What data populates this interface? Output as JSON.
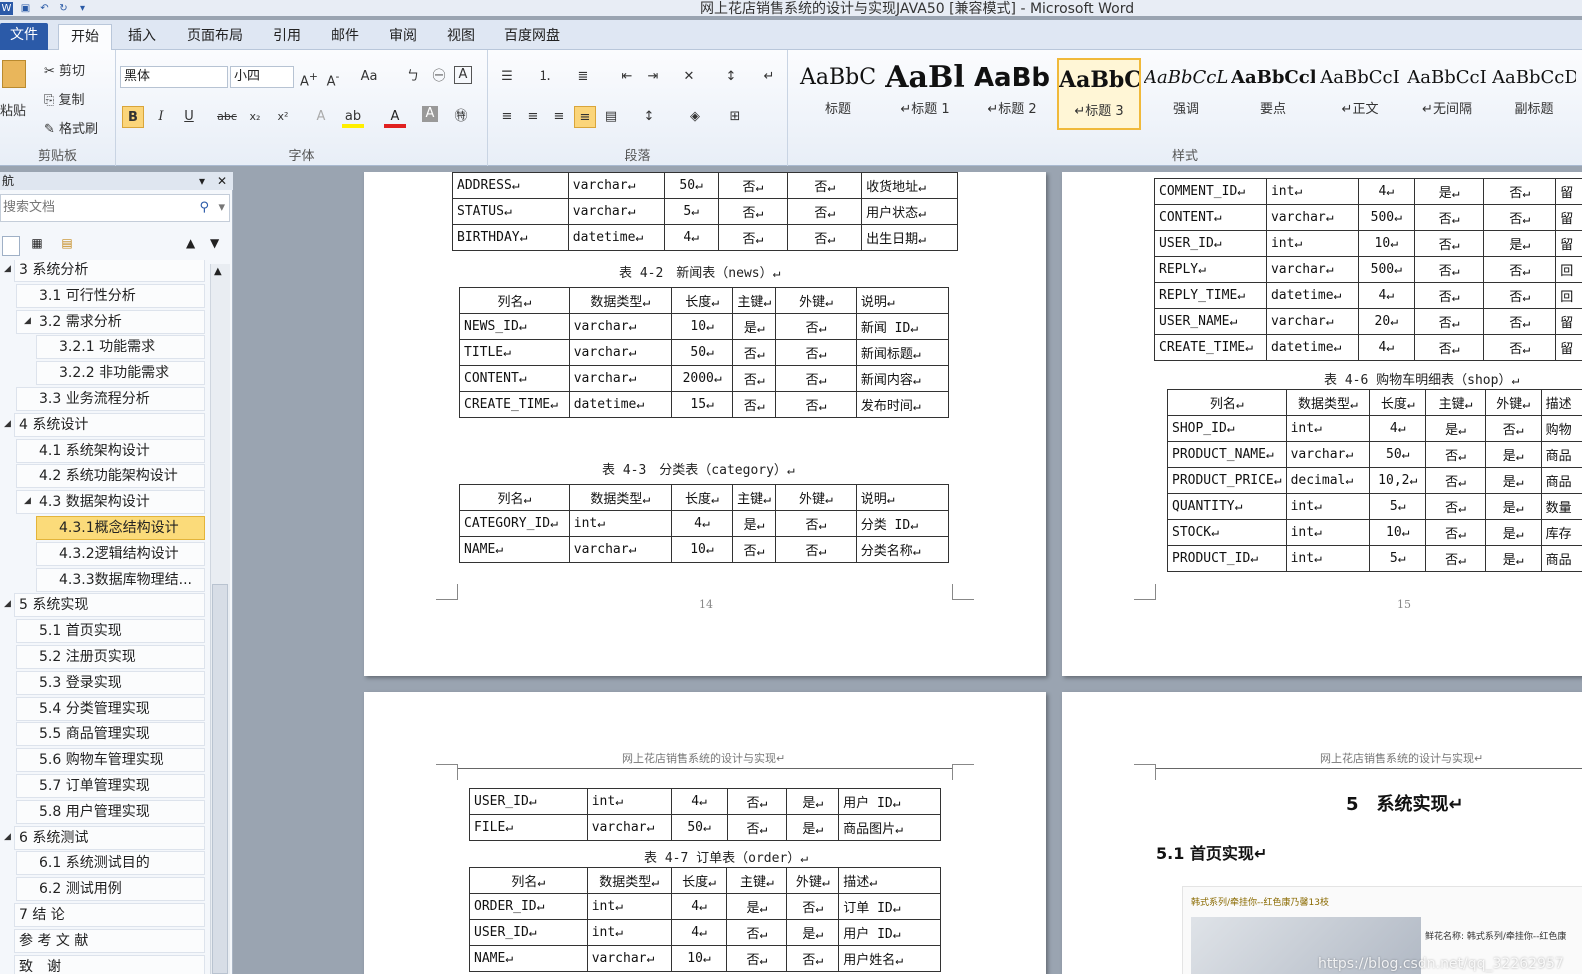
{
  "window": {
    "title": "网上花店销售系统的设计与实现JAVA50 [兼容模式] - Microsoft Word"
  },
  "tabs": [
    "文件",
    "开始",
    "插入",
    "页面布局",
    "引用",
    "邮件",
    "审阅",
    "视图",
    "百度网盘"
  ],
  "ribbon": {
    "clipboard": {
      "paste": "粘贴",
      "cut": "剪切",
      "copy": "复制",
      "format_painter": "格式刷",
      "label": "剪贴板"
    },
    "font": {
      "name": "黑体",
      "size": "小四",
      "label": "字体"
    },
    "paragraph": {
      "label": "段落"
    },
    "styles": {
      "label": "样式",
      "items": [
        {
          "sample": "AaBbC",
          "name": "标题"
        },
        {
          "sample": "AaBl",
          "name": "↵标题 1"
        },
        {
          "sample": "AaBb",
          "name": "↵标题 2"
        },
        {
          "sample": "AaBbC",
          "name": "↵标题 3"
        },
        {
          "sample": "AaBbCcL",
          "name": "强调"
        },
        {
          "sample": "AaBbCcl",
          "name": "要点"
        },
        {
          "sample": "AaBbCcI",
          "name": "↵正文"
        },
        {
          "sample": "AaBbCcI",
          "name": "↵无间隔"
        },
        {
          "sample": "AaBbCcD",
          "name": "副标题"
        }
      ]
    }
  },
  "nav": {
    "title": "航",
    "search_placeholder": "搜索文档",
    "items": [
      {
        "label": "3 系统分析",
        "level": 1
      },
      {
        "label": "3.1 可行性分析",
        "level": 2
      },
      {
        "label": "3.2 需求分析",
        "level": 2
      },
      {
        "label": "3.2.1 功能需求",
        "level": 3
      },
      {
        "label": "3.2.2 非功能需求",
        "level": 3
      },
      {
        "label": "3.3 业务流程分析",
        "level": 2
      },
      {
        "label": "4 系统设计",
        "level": 1
      },
      {
        "label": "4.1 系统架构设计",
        "level": 2
      },
      {
        "label": "4.2 系统功能架构设计",
        "level": 2
      },
      {
        "label": "4.3 数据架构设计",
        "level": 2
      },
      {
        "label": "4.3.1概念结构设计",
        "level": 3
      },
      {
        "label": "4.3.2逻辑结构设计",
        "level": 3
      },
      {
        "label": "4.3.3数据库物理结...",
        "level": 3
      },
      {
        "label": "5 系统实现",
        "level": 1
      },
      {
        "label": "5.1 首页实现",
        "level": 2
      },
      {
        "label": "5.2 注册页实现",
        "level": 2
      },
      {
        "label": "5.3 登录实现",
        "level": 2
      },
      {
        "label": "5.4 分类管理实现",
        "level": 2
      },
      {
        "label": "5.5 商品管理实现",
        "level": 2
      },
      {
        "label": "5.6 购物车管理实现",
        "level": 2
      },
      {
        "label": "5.7 订单管理实现",
        "level": 2
      },
      {
        "label": "5.8 用户管理实现",
        "level": 2
      },
      {
        "label": "6 系统测试",
        "level": 1
      },
      {
        "label": "6.1 系统测试目的",
        "level": 2
      },
      {
        "label": "6.2 测试用例",
        "level": 2
      },
      {
        "label": "7 结 论",
        "level": 1
      },
      {
        "label": "参 考 文 献",
        "level": 1
      },
      {
        "label": "致　谢",
        "level": 1
      }
    ]
  },
  "doc": {
    "p14": {
      "top_rows": [
        [
          "ADDRESS↵",
          "varchar↵",
          "50↵",
          "否↵",
          "否↵",
          "收货地址↵"
        ],
        [
          "STATUS↵",
          "varchar↵",
          "5↵",
          "否↵",
          "否↵",
          "用户状态↵"
        ],
        [
          "BIRTHDAY↵",
          "datetime↵",
          "4↵",
          "否↵",
          "否↵",
          "出生日期↵"
        ]
      ],
      "cap_news": "表 4-2　新闻表（news）↵",
      "news_rows": [
        [
          "列名↵",
          "数据类型↵",
          "长度↵",
          "主键↵",
          "外键↵",
          "说明↵"
        ],
        [
          "NEWS_ID↵",
          "varchar↵",
          "10↵",
          "是↵",
          "否↵",
          "新闻 ID↵"
        ],
        [
          "TITLE↵",
          "varchar↵",
          "50↵",
          "否↵",
          "否↵",
          "新闻标题↵"
        ],
        [
          "CONTENT↵",
          "varchar↵",
          "2000↵",
          "否↵",
          "否↵",
          "新闻内容↵"
        ],
        [
          "CREATE_TIME↵",
          "datetime↵",
          "15↵",
          "否↵",
          "否↵",
          "发布时间↵"
        ]
      ],
      "cap_category": "表 4-3　分类表（category）↵",
      "category_rows": [
        [
          "列名↵",
          "数据类型↵",
          "长度↵",
          "主键↵",
          "外键↵",
          "说明↵"
        ],
        [
          "CATEGORY_ID↵",
          "int↵",
          "4↵",
          "是↵",
          "否↵",
          "分类 ID↵"
        ],
        [
          "NAME↵",
          "varchar↵",
          "10↵",
          "否↵",
          "否↵",
          "分类名称↵"
        ]
      ],
      "page_no": "14"
    },
    "p15": {
      "top_rows": [
        [
          "COMMENT_ID↵",
          "int↵",
          "4↵",
          "是↵",
          "否↵",
          "留"
        ],
        [
          "CONTENT↵",
          "varchar↵",
          "500↵",
          "否↵",
          "否↵",
          "留"
        ],
        [
          "USER_ID↵",
          "int↵",
          "10↵",
          "否↵",
          "是↵",
          "留"
        ],
        [
          "REPLY↵",
          "varchar↵",
          "500↵",
          "否↵",
          "否↵",
          "回"
        ],
        [
          "REPLY_TIME↵",
          "datetime↵",
          "4↵",
          "否↵",
          "否↵",
          "回"
        ],
        [
          "USER_NAME↵",
          "varchar↵",
          "20↵",
          "否↵",
          "否↵",
          "留"
        ],
        [
          "CREATE_TIME↵",
          "datetime↵",
          "4↵",
          "否↵",
          "否↵",
          "留"
        ]
      ],
      "cap_shop": "表 4-6 购物车明细表（shop）↵",
      "shop_rows": [
        [
          "列名↵",
          "数据类型↵",
          "长度↵",
          "主键↵",
          "外键↵",
          "描述"
        ],
        [
          "SHOP_ID↵",
          "int↵",
          "4↵",
          "是↵",
          "否↵",
          "购物"
        ],
        [
          "PRODUCT_NAME↵",
          "varchar↵",
          "50↵",
          "否↵",
          "是↵",
          "商品"
        ],
        [
          "PRODUCT_PRICE↵",
          "decimal↵",
          "10,2↵",
          "否↵",
          "是↵",
          "商品"
        ],
        [
          "QUANTITY↵",
          "int↵",
          "5↵",
          "否↵",
          "是↵",
          "数量"
        ],
        [
          "STOCK↵",
          "int↵",
          "10↵",
          "否↵",
          "是↵",
          "库存"
        ],
        [
          "PRODUCT_ID↵",
          "int↵",
          "5↵",
          "否↵",
          "是↵",
          "商品"
        ]
      ],
      "page_no": "15"
    },
    "p16": {
      "header": "网上花店销售系统的设计与实现↵",
      "top_rows": [
        [
          "USER_ID↵",
          "int↵",
          "4↵",
          "否↵",
          "是↵",
          "用户 ID↵"
        ],
        [
          "FILE↵",
          "varchar↵",
          "50↵",
          "否↵",
          "是↵",
          "商品图片↵"
        ]
      ],
      "cap_order": "表 4-7 订单表（order）↵",
      "order_rows": [
        [
          "列名↵",
          "数据类型↵",
          "长度↵",
          "主键↵",
          "外键↵",
          "描述↵"
        ],
        [
          "ORDER_ID↵",
          "int↵",
          "4↵",
          "是↵",
          "否↵",
          "订单 ID↵"
        ],
        [
          "USER_ID↵",
          "int↵",
          "4↵",
          "否↵",
          "是↵",
          "用户 ID↵"
        ],
        [
          "NAME↵",
          "varchar↵",
          "10↵",
          "否↵",
          "否↵",
          "用户姓名↵"
        ]
      ]
    },
    "p17": {
      "header": "网上花店销售系统的设计与实现↵",
      "h1": "5　系统实现↵",
      "h2": "5.1 首页实现↵",
      "img_banner": "韩式系列/牵挂你--红色康乃馨13枝",
      "img_label": "鲜花名称: 韩式系列/牵挂你--红色康",
      "watermark": "https://blog.csdn.net/qq_32262957"
    }
  }
}
